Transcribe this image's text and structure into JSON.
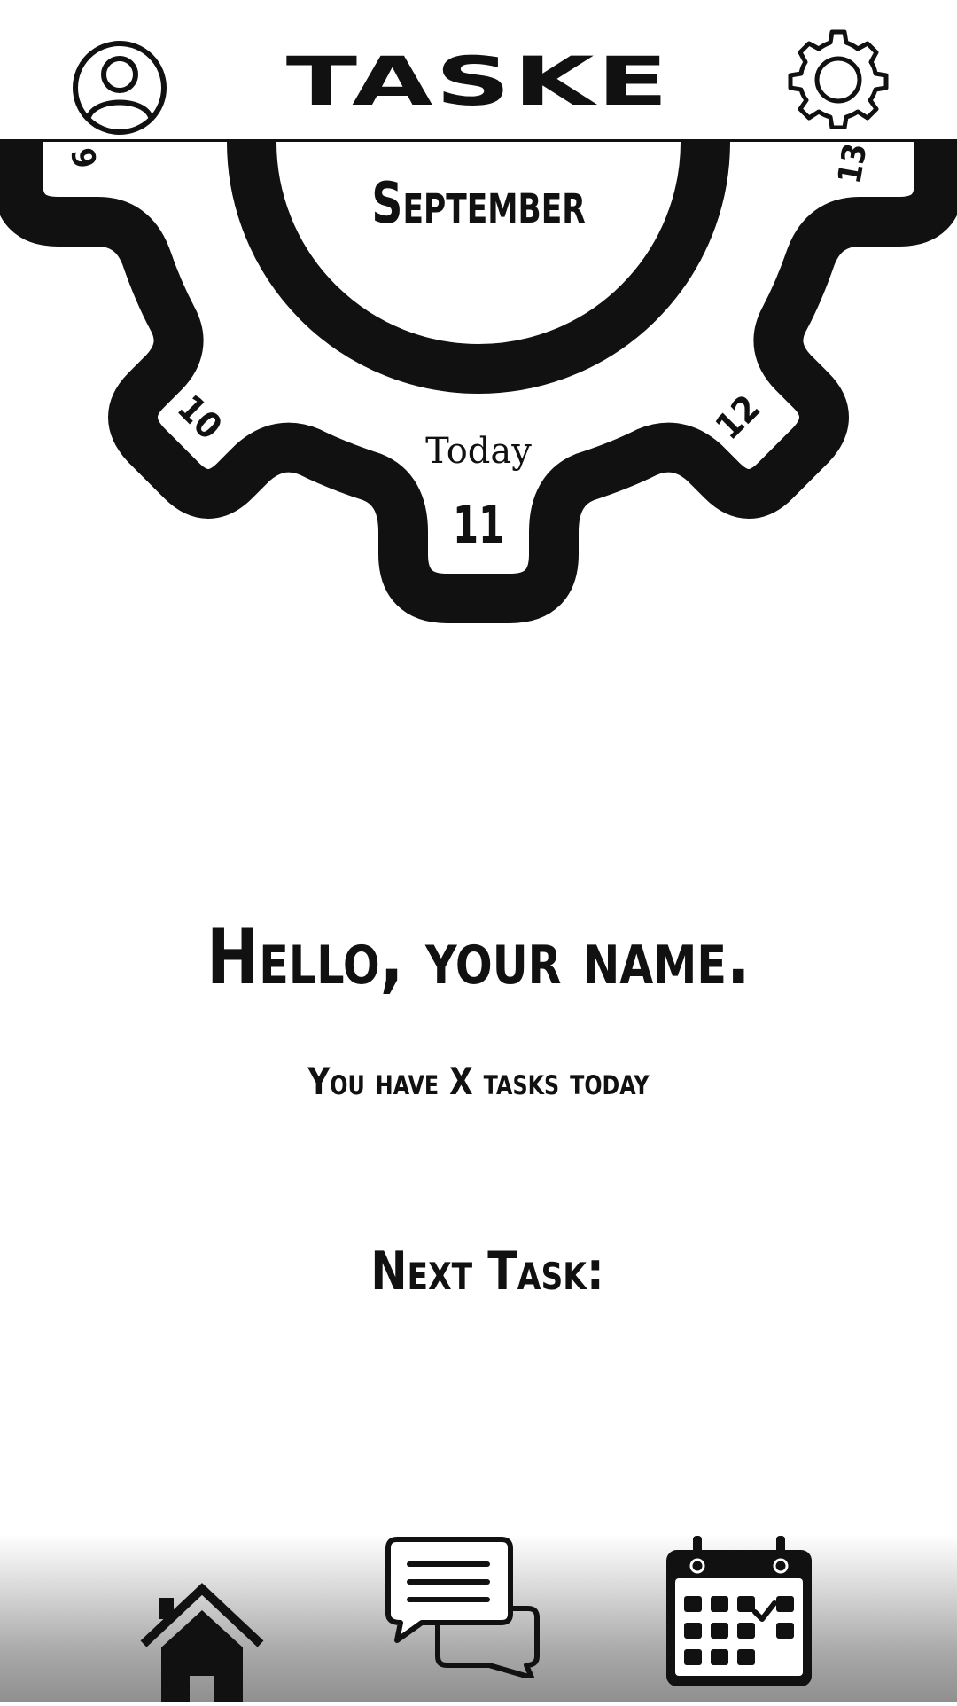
{
  "header": {
    "app_title": "TASKE",
    "profile_icon": "user-circle-icon",
    "settings_icon": "gear-icon"
  },
  "date_picker": {
    "month": "September",
    "today_label": "Today",
    "current_day": "11",
    "visible_days": [
      "9",
      "10",
      "11",
      "12",
      "13"
    ]
  },
  "main": {
    "greeting": "Hello, your name.",
    "task_summary": "You have X tasks today",
    "next_task_label": "Next Task:"
  },
  "bottom_nav": {
    "items": [
      {
        "icon": "home-icon"
      },
      {
        "icon": "chat-bubbles-icon"
      },
      {
        "icon": "calendar-icon"
      }
    ]
  },
  "colors": {
    "primary": "#111111",
    "background": "#ffffff",
    "nav_gradient_bottom": "#8f8f8f"
  }
}
